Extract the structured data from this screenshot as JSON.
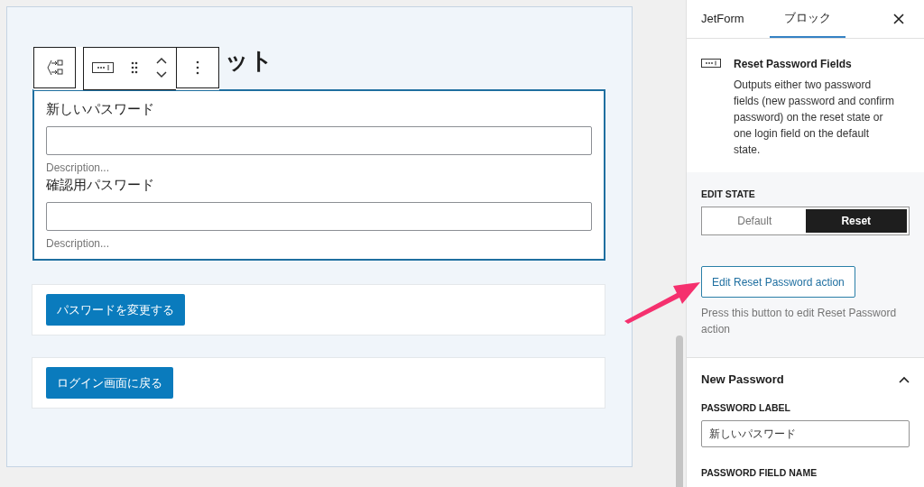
{
  "canvas": {
    "heading": "ット",
    "block_selected": true,
    "fields": [
      {
        "label": "新しいパスワード",
        "description": "Description..."
      },
      {
        "label": "確認用パスワード",
        "description": "Description..."
      }
    ],
    "buttons": [
      {
        "label": "パスワードを変更する"
      },
      {
        "label": "ログイン画面に戻る"
      }
    ]
  },
  "sidebar": {
    "tabs": [
      {
        "label": "JetForm",
        "selected": false
      },
      {
        "label": "ブロック",
        "selected": true
      }
    ],
    "block": {
      "title": "Reset Password Fields",
      "description": "Outputs either two password fields (new password and confirm password) on the reset state or one login field on the default state."
    },
    "edit_state": {
      "label": "EDIT STATE",
      "options": [
        {
          "label": "Default",
          "selected": false
        },
        {
          "label": "Reset",
          "selected": true
        }
      ],
      "action_button": "Edit Reset Password action",
      "hint": "Press this button to edit Reset Password action"
    },
    "new_password": {
      "title": "New Password",
      "expanded": true,
      "fields": [
        {
          "label": "PASSWORD LABEL",
          "value": "新しいパスワード"
        },
        {
          "label": "PASSWORD FIELD NAME"
        }
      ]
    }
  }
}
